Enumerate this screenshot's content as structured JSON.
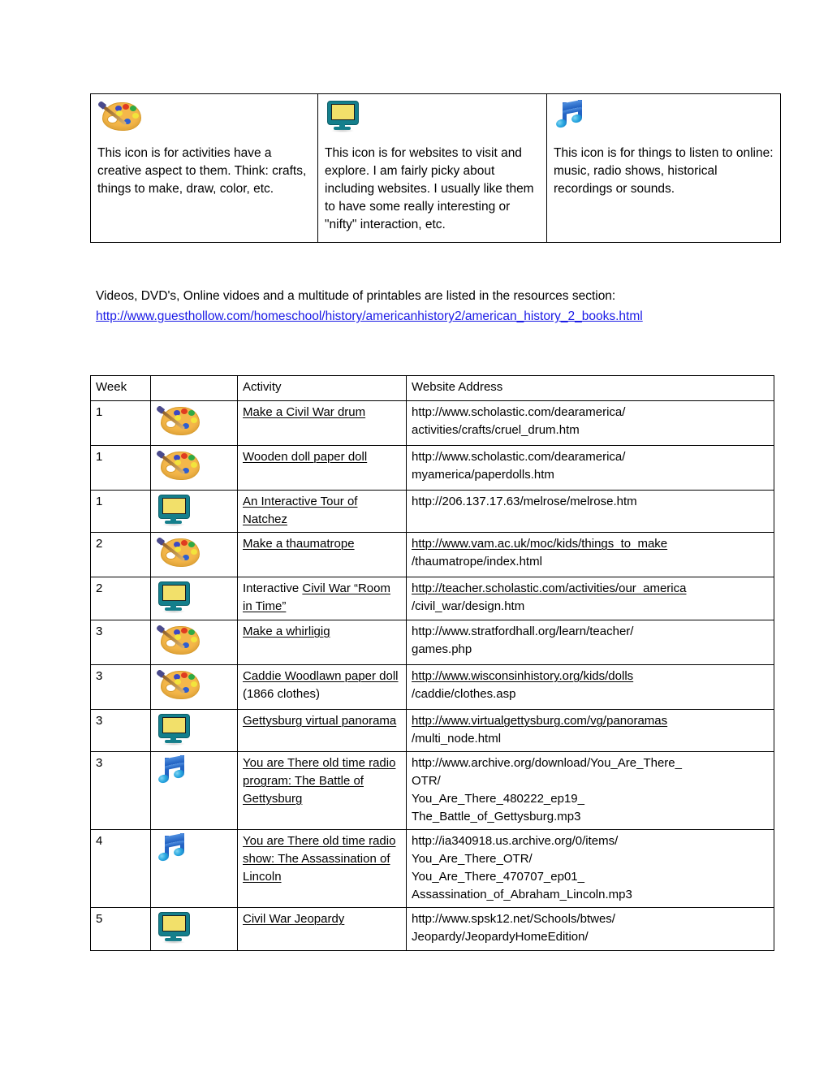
{
  "legend": {
    "columns": [
      {
        "icon": "palette-icon",
        "text": "This icon is for activities have a creative aspect to them. Think: crafts, things to make, draw, color, etc."
      },
      {
        "icon": "monitor-icon",
        "text": "This icon is for websites to visit and explore. I am fairly picky about including websites. I usually like them to have some really interesting or \"nifty\" interaction, etc."
      },
      {
        "icon": "music-note-icon",
        "text": "This icon is for things to listen to online: music, radio shows, historical recordings or sounds."
      }
    ]
  },
  "resources": {
    "intro": "Videos, DVD's, Online vidoes and a multitude of printables are listed in the resources section:",
    "link": "http://www.guesthollow.com/homeschool/history/americanhistory2/american_history_2_books.html",
    "link_color": "#1a1ae6"
  },
  "schedule": {
    "headers": {
      "week": "Week",
      "icon": "",
      "activity": "Activity",
      "url": "Website Address"
    },
    "rows": [
      {
        "week": "1",
        "icon": "palette-icon",
        "activity_underlined": "Make a Civil War drum",
        "activity_plain": "",
        "url_lines": [
          "http://www.scholastic.com/dearamerica/",
          "activities/crafts/cruel_drum.htm"
        ],
        "url_underlined": false
      },
      {
        "week": "1",
        "icon": "palette-icon",
        "activity_underlined": "Wooden doll paper doll",
        "activity_plain": "",
        "url_lines": [
          "http://www.scholastic.com/dearamerica/",
          "myamerica/paperdolls.htm"
        ],
        "url_underlined": false
      },
      {
        "week": "1",
        "icon": "monitor-icon",
        "activity_underlined": "An Interactive Tour of Natchez",
        "activity_plain": "",
        "url_lines": [
          "http://206.137.17.63/melrose/melrose.htm"
        ],
        "url_underlined": false
      },
      {
        "week": "2",
        "icon": "palette-icon",
        "activity_underlined": "Make a thaumatrope",
        "activity_plain": "",
        "url_lines": [
          "http://www.vam.ac.uk/moc/kids/things_to_make",
          "/thaumatrope/index.html"
        ],
        "url_underlined": true
      },
      {
        "week": "2",
        "icon": "monitor-icon",
        "activity_prefix": "Interactive ",
        "activity_underlined": "Civil War “Room in Time”",
        "activity_plain": "",
        "url_lines": [
          "http://teacher.scholastic.com/activities/our_america",
          "/civil_war/design.htm"
        ],
        "url_underlined": true
      },
      {
        "week": "3",
        "icon": "palette-icon",
        "activity_underlined": "Make a whirligig",
        "activity_plain": "",
        "url_lines": [
          "http://www.stratfordhall.org/learn/teacher/",
          "games.php"
        ],
        "url_underlined": false
      },
      {
        "week": "3",
        "icon": "palette-icon",
        "activity_underlined": "Caddie Woodlawn paper doll",
        "activity_plain": "(1866 clothes)",
        "url_lines": [
          "http://www.wisconsinhistory.org/kids/dolls",
          "/caddie/clothes.asp"
        ],
        "url_underlined": true
      },
      {
        "week": "3",
        "icon": "monitor-icon",
        "activity_underlined": "Gettysburg virtual panorama",
        "activity_plain": "",
        "url_lines": [
          "http://www.virtualgettysburg.com/vg/panoramas",
          "/multi_node.html"
        ],
        "url_underlined": true
      },
      {
        "week": "3",
        "icon": "music-note-icon",
        "activity_underlined": "You are There old time radio program: The Battle of Gettysburg",
        "activity_plain": "",
        "url_lines": [
          "http://www.archive.org/download/You_Are_There_",
          "OTR/",
          "You_Are_There_480222_ep19_",
          "The_Battle_of_Gettysburg.mp3"
        ],
        "url_underlined": false
      },
      {
        "week": "4",
        "icon": "music-note-icon",
        "activity_underlined": "You are There old time radio show: The Assassination of Lincoln",
        "activity_plain": "",
        "url_lines": [
          "http://ia340918.us.archive.org/0/items/",
          "You_Are_There_OTR/",
          "You_Are_There_470707_ep01_",
          "Assassination_of_Abraham_Lincoln.mp3"
        ],
        "url_underlined": false
      },
      {
        "week": "5",
        "icon": "monitor-icon",
        "activity_underlined": "Civil War Jeopardy",
        "activity_plain": "",
        "url_lines": [
          "http://www.spsk12.net/Schools/btwes/",
          "Jeopardy/JeopardyHomeEdition/"
        ],
        "url_underlined": false
      }
    ]
  }
}
